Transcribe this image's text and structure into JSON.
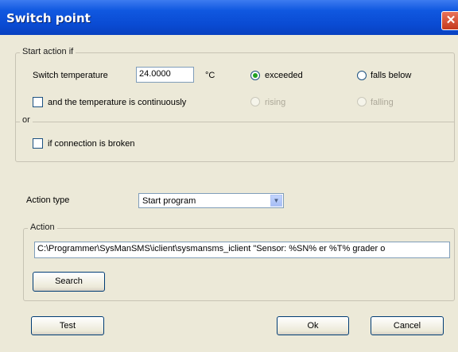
{
  "window": {
    "title": "Switch point"
  },
  "start_action": {
    "legend": "Start action if",
    "switch_temp_label": "Switch temperature",
    "switch_temp_value": "24.0000",
    "unit": "°C",
    "exceeded_label": "exceeded",
    "falls_below_label": "falls below",
    "continuously_label": "and the temperature is continuously",
    "rising_label": "rising",
    "falling_label": "falling",
    "or_label": "or",
    "connection_broken_label": "if connection is broken"
  },
  "action_type": {
    "label": "Action type",
    "selected": "Start program"
  },
  "action": {
    "legend": "Action",
    "value": "C:\\Programmer\\SysManSMS\\iclient\\sysmansms_iclient \"Sensor: %SN% er %T% grader o",
    "search_label": "Search"
  },
  "buttons": {
    "test": "Test",
    "ok": "Ok",
    "cancel": "Cancel"
  }
}
